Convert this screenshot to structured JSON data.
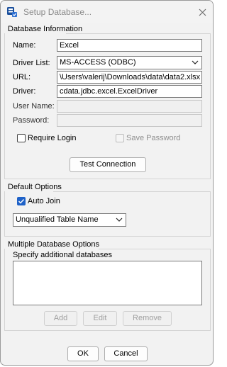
{
  "window": {
    "title": "Setup Database..."
  },
  "colors": {
    "accent": "#1f62c8",
    "icon_blue": "#1a4f9c"
  },
  "icons": {
    "app": "database-icon",
    "close": "close-icon",
    "dropdown": "chevron-down-icon",
    "check": "checkmark-icon"
  },
  "database_info": {
    "group_label": "Database Information",
    "name_label": "Name:",
    "name_value": "Excel",
    "driver_list_label": "Driver List:",
    "driver_list_value": "MS-ACCESS (ODBC)",
    "url_label": "URL:",
    "url_value": "\\Users\\valerij\\Downloads\\data\\data2.xlsx",
    "driver_label": "Driver:",
    "driver_value": "cdata.jdbc.excel.ExcelDriver",
    "user_name_label": "User Name:",
    "user_name_value": "",
    "password_label": "Password:",
    "password_value": "",
    "require_login_label": "Require Login",
    "require_login_checked": false,
    "save_password_label": "Save Password",
    "save_password_checked": false,
    "test_connection_label": "Test Connection"
  },
  "default_options": {
    "group_label": "Default Options",
    "auto_join_label": "Auto Join",
    "auto_join_checked": true,
    "table_name_mode_value": "Unqualified Table Name"
  },
  "multiple_db": {
    "group_label": "Multiple Database Options",
    "specify_label": "Specify additional databases",
    "databases": [],
    "add_label": "Add",
    "edit_label": "Edit",
    "remove_label": "Remove"
  },
  "footer": {
    "ok_label": "OK",
    "cancel_label": "Cancel"
  }
}
